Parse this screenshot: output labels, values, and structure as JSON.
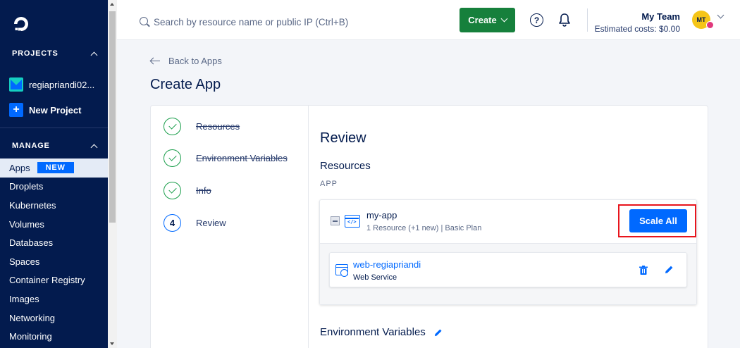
{
  "sidebar": {
    "projects_heading": "PROJECTS",
    "project_name": "regiapriandi02...",
    "new_project_label": "New Project",
    "manage_heading": "MANAGE",
    "items": [
      {
        "label": "Apps",
        "badge": "NEW",
        "active": true
      },
      {
        "label": "Droplets"
      },
      {
        "label": "Kubernetes"
      },
      {
        "label": "Volumes"
      },
      {
        "label": "Databases"
      },
      {
        "label": "Spaces"
      },
      {
        "label": "Container Registry"
      },
      {
        "label": "Images"
      },
      {
        "label": "Networking"
      },
      {
        "label": "Monitoring"
      }
    ]
  },
  "header": {
    "search_placeholder": "Search by resource name or public IP (Ctrl+B)",
    "create_label": "Create",
    "help_glyph": "?",
    "team_name": "My Team",
    "estimated_costs": "Estimated costs: $0.00",
    "avatar_initials": "MT"
  },
  "main": {
    "back_label": "Back to Apps",
    "page_title": "Create App",
    "steps": [
      {
        "label": "Resources",
        "status": "done"
      },
      {
        "label": "Environment Variables",
        "status": "done"
      },
      {
        "label": "Info",
        "status": "done"
      },
      {
        "number": "4",
        "label": "Review",
        "status": "current"
      }
    ],
    "review_title": "Review",
    "resources_title": "Resources",
    "app_section_label": "APP",
    "app": {
      "name": "my-app",
      "meta": "1 Resource (+1 new) | Basic Plan",
      "scale_label": "Scale All",
      "code_glyph": "</>"
    },
    "service": {
      "name": "web-regiapriandi",
      "type": "Web Service"
    },
    "env_title": "Environment Variables"
  },
  "colors": {
    "sidebar_bg": "#031b4e",
    "primary": "#0069ff",
    "create_green": "#16803c",
    "highlight_red": "#e8141c"
  }
}
